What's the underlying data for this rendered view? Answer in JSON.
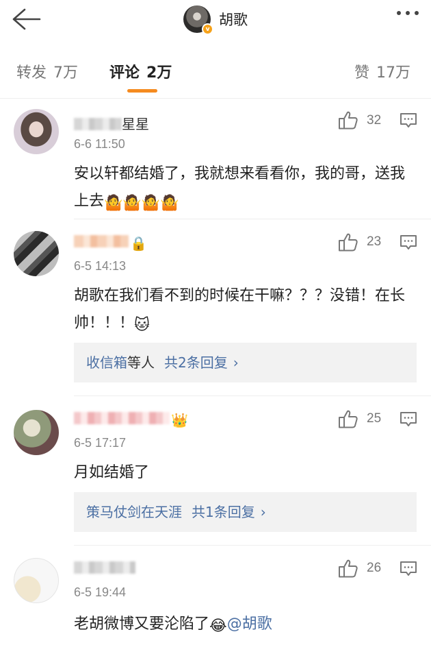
{
  "header": {
    "name": "胡歌",
    "verified_badge": "v"
  },
  "tabs": [
    {
      "label": "转发",
      "count": "7万"
    },
    {
      "label": "评论",
      "count": "2万"
    },
    {
      "label": "赞",
      "count": "17万"
    }
  ],
  "accent_color": "#f58b1f",
  "link_color": "#4b6fa3",
  "comments": [
    {
      "username_suffix": "星星",
      "time": "6-6 11:50",
      "likes": "32",
      "content": "安以轩都结婚了，我就想来看看你，我的哥，送我上去",
      "emojis": [
        "🤷",
        "🤷",
        "🤷",
        "🤷"
      ]
    },
    {
      "username_suffix": "",
      "badge_icon": "🔒",
      "time": "6-5 14:13",
      "likes": "23",
      "content": "胡歌在我们看不到的时候在干嘛？？？没错！在长帅！！！",
      "emojis": [
        "🐱"
      ],
      "replies": {
        "name": "收信箱",
        "text": "等人",
        "count": "共2条回复",
        "chevron": "›"
      }
    },
    {
      "username_suffix": "",
      "badge_icon": "👑",
      "time": "6-5 17:17",
      "likes": "25",
      "content": "月如结婚了",
      "replies": {
        "name": "策马仗剑在天涯",
        "text": "",
        "count": "共1条回复",
        "chevron": "›"
      }
    },
    {
      "username_suffix": "",
      "time": "6-5 19:44",
      "likes": "26",
      "content": "老胡微博又要沦陷了",
      "emojis": [
        "😂"
      ],
      "mention": "@胡歌"
    }
  ]
}
